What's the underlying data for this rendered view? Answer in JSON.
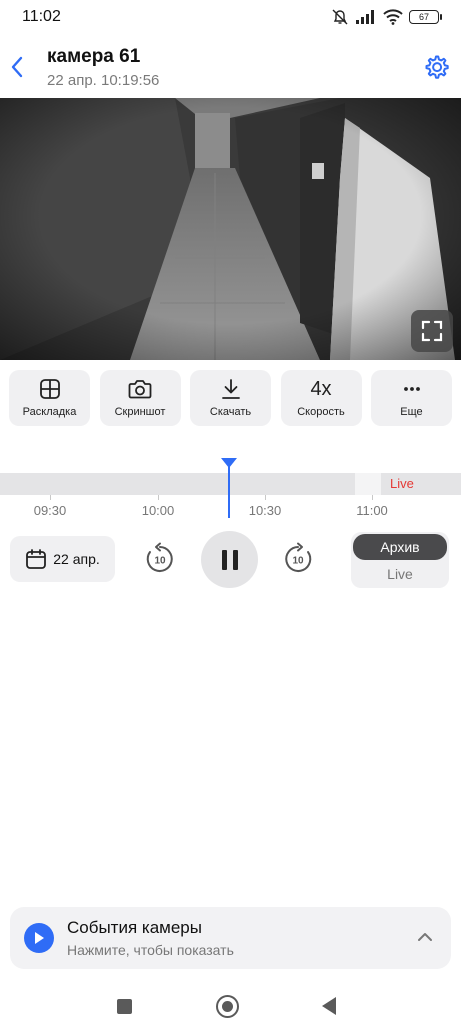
{
  "status_bar": {
    "time": "11:02",
    "battery": "67"
  },
  "header": {
    "title": "камера 61",
    "subtitle": "22 апр. 10:19:56"
  },
  "actions": [
    {
      "label": "Раскладка",
      "icon": "grid-icon"
    },
    {
      "label": "Скриншот",
      "icon": "camera-icon"
    },
    {
      "label": "Скачать",
      "icon": "download-icon"
    },
    {
      "label": "Скорость",
      "icon": "speed-icon",
      "icon_text": "4x"
    },
    {
      "label": "Еще",
      "icon": "more-icon"
    }
  ],
  "timeline": {
    "ticks": [
      "09:30",
      "10:00",
      "10:30",
      "11:00"
    ],
    "live_label": "Live",
    "accent": "#2f6cf6",
    "live_color": "#e53935"
  },
  "controls": {
    "date_label": "22 апр.",
    "rewind_seconds": "10",
    "forward_seconds": "10",
    "mode_archive": "Архив",
    "mode_live": "Live"
  },
  "events": {
    "title": "События камеры",
    "subtitle": "Нажмите, чтобы показать"
  }
}
